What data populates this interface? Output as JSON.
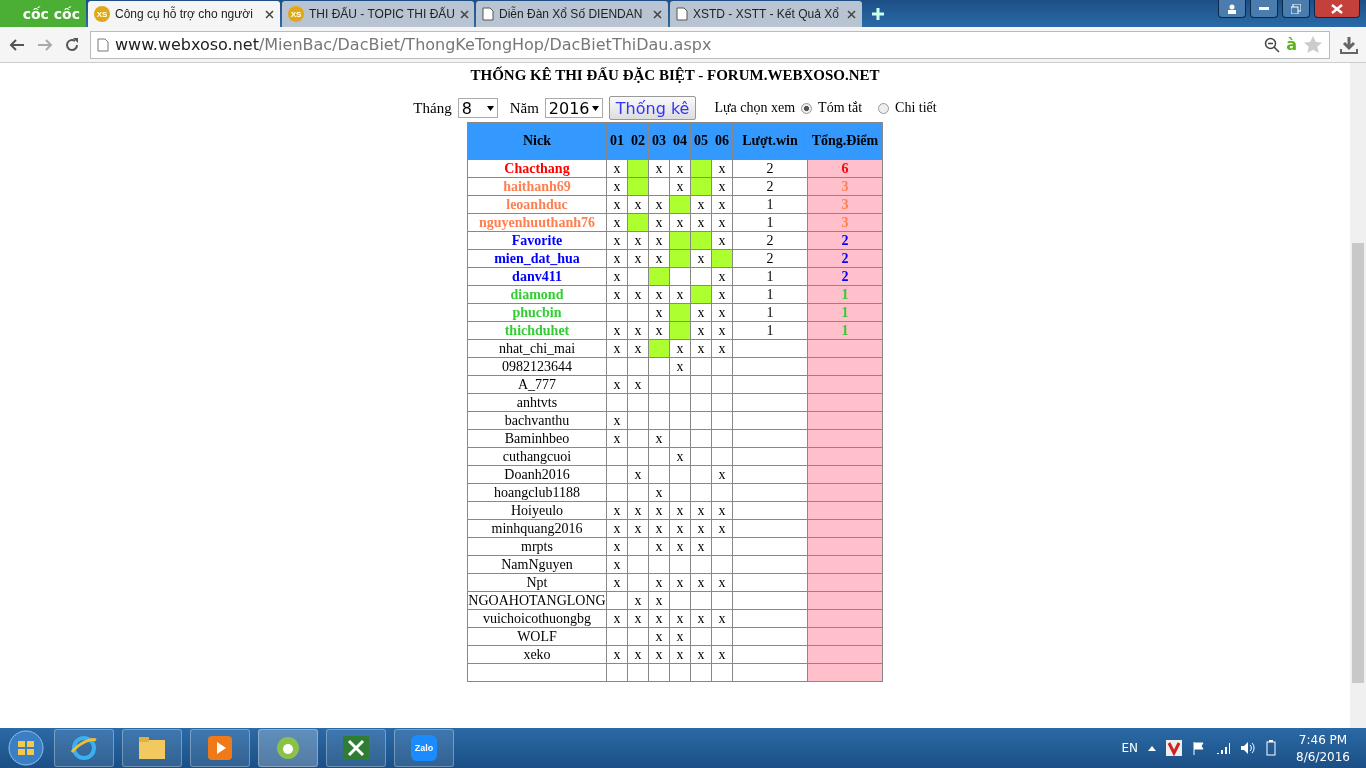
{
  "browser": {
    "logo": "cốc cốc",
    "tabs": [
      {
        "title": "Công cụ hỗ trợ cho người",
        "favicon": "XS",
        "selected": true
      },
      {
        "title": "THI ĐẤU - TOPIC THI ĐẤU",
        "favicon": "XS",
        "selected": false
      },
      {
        "title": "Diễn Đàn Xổ Số DIENDAN",
        "selected": false
      },
      {
        "title": "XSTD - XSTT - Kết Quả Xổ",
        "selected": false
      }
    ],
    "url_host": "www.webxoso.net",
    "url_path": "/MienBac/DacBiet/ThongKeTongHop/DacBietThiDau.aspx",
    "toolbar_letter": "à"
  },
  "page": {
    "title": "THỐNG KÊ THI ĐẤU ĐẶC BIỆT - FORUM.WEBXOSO.NET",
    "month_label": "Tháng",
    "month": "8",
    "year_label": "Năm",
    "year": "2016",
    "submit": "Thống kê",
    "view_label": "Lựa chọn xem",
    "view_options": [
      {
        "label": "Tóm tắt",
        "selected": true
      },
      {
        "label": "Chi tiết",
        "selected": false
      }
    ],
    "columns": [
      "Nick",
      "01",
      "02",
      "03",
      "04",
      "05",
      "06",
      "Lượt.win",
      "Tổng.Điểm"
    ],
    "rows": [
      {
        "cells": [
          {
            "text": "Chacthang"
          },
          {
            "text": "x",
            "win": false
          },
          {
            "win": true
          },
          {
            "text": "x",
            "win": false
          },
          {
            "text": "x",
            "win": false
          },
          {
            "win": true
          },
          {
            "text": "x",
            "win": false
          },
          {
            "text": "2"
          },
          {
            "text": "6"
          }
        ],
        "color": "#ff0000"
      },
      {
        "cells": [
          {
            "text": "haithanh69"
          },
          {
            "text": "x",
            "win": false
          },
          {
            "win": true
          },
          {
            "win": false
          },
          {
            "text": "x",
            "win": false
          },
          {
            "win": true
          },
          {
            "text": "x",
            "win": false
          },
          {
            "text": "2"
          },
          {
            "text": "3"
          }
        ],
        "color": "#ff7f50"
      },
      {
        "cells": [
          {
            "text": "leoanhduc"
          },
          {
            "text": "x",
            "win": false
          },
          {
            "text": "x",
            "win": false
          },
          {
            "text": "x",
            "win": false
          },
          {
            "win": true
          },
          {
            "text": "x",
            "win": false
          },
          {
            "text": "x",
            "win": false
          },
          {
            "text": "1"
          },
          {
            "text": "3"
          }
        ],
        "color": "#ff7f50"
      },
      {
        "cells": [
          {
            "text": "nguyenhuuthanh76"
          },
          {
            "text": "x",
            "win": false
          },
          {
            "win": true
          },
          {
            "text": "x",
            "win": false
          },
          {
            "text": "x",
            "win": false
          },
          {
            "text": "x",
            "win": false
          },
          {
            "text": "x",
            "win": false
          },
          {
            "text": "1"
          },
          {
            "text": "3"
          }
        ],
        "color": "#ff7f50"
      },
      {
        "cells": [
          {
            "text": "Favorite"
          },
          {
            "text": "x",
            "win": false
          },
          {
            "text": "x",
            "win": false
          },
          {
            "text": "x",
            "win": false
          },
          {
            "win": true
          },
          {
            "win": true
          },
          {
            "text": "x",
            "win": false
          },
          {
            "text": "2"
          },
          {
            "text": "2"
          }
        ],
        "color": "#0000ff"
      },
      {
        "cells": [
          {
            "text": "mien_dat_hua"
          },
          {
            "text": "x",
            "win": false
          },
          {
            "text": "x",
            "win": false
          },
          {
            "text": "x",
            "win": false
          },
          {
            "win": true
          },
          {
            "text": "x",
            "win": false
          },
          {
            "win": true
          },
          {
            "text": "2"
          },
          {
            "text": "2"
          }
        ],
        "color": "#0000ff"
      },
      {
        "cells": [
          {
            "text": "danv411"
          },
          {
            "text": "x",
            "win": false
          },
          {
            "win": false
          },
          {
            "win": true
          },
          {
            "win": false
          },
          {
            "win": false
          },
          {
            "text": "x",
            "win": false
          },
          {
            "text": "1"
          },
          {
            "text": "2"
          }
        ],
        "color": "#0000ff"
      },
      {
        "cells": [
          {
            "text": "diamond"
          },
          {
            "text": "x",
            "win": false
          },
          {
            "text": "x",
            "win": false
          },
          {
            "text": "x",
            "win": false
          },
          {
            "text": "x",
            "win": false
          },
          {
            "win": true
          },
          {
            "text": "x",
            "win": false
          },
          {
            "text": "1"
          },
          {
            "text": "1"
          }
        ],
        "color": "#33cc33"
      },
      {
        "cells": [
          {
            "text": "phucbin"
          },
          {
            "win": false
          },
          {
            "win": false
          },
          {
            "text": "x",
            "win": false
          },
          {
            "win": true
          },
          {
            "text": "x",
            "win": false
          },
          {
            "text": "x",
            "win": false
          },
          {
            "text": "1"
          },
          {
            "text": "1"
          }
        ],
        "color": "#33cc33"
      },
      {
        "cells": [
          {
            "text": "thichduhet"
          },
          {
            "text": "x",
            "win": false
          },
          {
            "text": "x",
            "win": false
          },
          {
            "text": "x",
            "win": false
          },
          {
            "win": true
          },
          {
            "text": "x",
            "win": false
          },
          {
            "text": "x",
            "win": false
          },
          {
            "text": "1"
          },
          {
            "text": "1"
          }
        ],
        "color": "#33cc33"
      },
      {
        "cells": [
          {
            "text": "nhat_chi_mai"
          },
          {
            "text": "x",
            "win": false
          },
          {
            "text": "x",
            "win": false
          },
          {
            "win": true
          },
          {
            "text": "x",
            "win": false
          },
          {
            "text": "x",
            "win": false
          },
          {
            "text": "x",
            "win": false
          }
        ]
      },
      {
        "cells": [
          {
            "text": "0982123644"
          },
          {
            "win": false
          },
          {
            "win": false
          },
          {
            "win": false
          },
          {
            "text": "x",
            "win": false
          },
          {
            "win": false
          },
          {
            "win": false
          }
        ]
      },
      {
        "cells": [
          {
            "text": "A_777"
          },
          {
            "text": "x",
            "win": false
          },
          {
            "text": "x",
            "win": false
          },
          {
            "win": false
          },
          {
            "win": false
          },
          {
            "win": false
          },
          {
            "win": false
          }
        ]
      },
      {
        "cells": [
          {
            "text": "anhtvts"
          },
          {
            "win": false
          },
          {
            "win": false
          },
          {
            "win": false
          },
          {
            "win": false
          },
          {
            "win": false
          },
          {
            "win": false
          }
        ]
      },
      {
        "cells": [
          {
            "text": "bachvanthu"
          },
          {
            "text": "x",
            "win": false
          },
          {
            "win": false
          },
          {
            "win": false
          },
          {
            "win": false
          },
          {
            "win": false
          },
          {
            "win": false
          }
        ]
      },
      {
        "cells": [
          {
            "text": "Baminhbeo"
          },
          {
            "text": "x",
            "win": false
          },
          {
            "win": false
          },
          {
            "text": "x",
            "win": false
          },
          {
            "win": false
          },
          {
            "win": false
          },
          {
            "win": false
          }
        ]
      },
      {
        "cells": [
          {
            "text": "cuthangcuoi"
          },
          {
            "win": false
          },
          {
            "win": false
          },
          {
            "win": false
          },
          {
            "text": "x",
            "win": false
          },
          {
            "win": false
          },
          {
            "win": false
          }
        ]
      },
      {
        "cells": [
          {
            "text": "Doanh2016"
          },
          {
            "win": false
          },
          {
            "text": "x",
            "win": false
          },
          {
            "win": false
          },
          {
            "win": false
          },
          {
            "win": false
          },
          {
            "text": "x",
            "win": false
          }
        ]
      },
      {
        "cells": [
          {
            "text": "hoangclub1188"
          },
          {
            "win": false
          },
          {
            "win": false
          },
          {
            "text": "x",
            "win": false
          },
          {
            "win": false
          },
          {
            "win": false
          },
          {
            "win": false
          }
        ]
      },
      {
        "cells": [
          {
            "text": "Hoiyeulo"
          },
          {
            "text": "x",
            "win": false
          },
          {
            "text": "x",
            "win": false
          },
          {
            "text": "x",
            "win": false
          },
          {
            "text": "x",
            "win": false
          },
          {
            "text": "x",
            "win": false
          },
          {
            "text": "x",
            "win": false
          }
        ]
      },
      {
        "cells": [
          {
            "text": "minhquang2016"
          },
          {
            "text": "x",
            "win": false
          },
          {
            "text": "x",
            "win": false
          },
          {
            "text": "x",
            "win": false
          },
          {
            "text": "x",
            "win": false
          },
          {
            "text": "x",
            "win": false
          },
          {
            "text": "x",
            "win": false
          }
        ]
      },
      {
        "cells": [
          {
            "text": "mrpts"
          },
          {
            "text": "x",
            "win": false
          },
          {
            "win": false
          },
          {
            "text": "x",
            "win": false
          },
          {
            "text": "x",
            "win": false
          },
          {
            "text": "x",
            "win": false
          },
          {
            "win": false
          }
        ]
      },
      {
        "cells": [
          {
            "text": "NamNguyen"
          },
          {
            "text": "x",
            "win": false
          },
          {
            "win": false
          },
          {
            "win": false
          },
          {
            "win": false
          },
          {
            "win": false
          },
          {
            "win": false
          }
        ]
      },
      {
        "cells": [
          {
            "text": "Npt"
          },
          {
            "text": "x",
            "win": false
          },
          {
            "win": false
          },
          {
            "text": "x",
            "win": false
          },
          {
            "text": "x",
            "win": false
          },
          {
            "text": "x",
            "win": false
          },
          {
            "text": "x",
            "win": false
          }
        ]
      },
      {
        "cells": [
          {
            "text": "NGOAHOTANGLONG"
          },
          {
            "win": false
          },
          {
            "text": "x",
            "win": false
          },
          {
            "text": "x",
            "win": false
          },
          {
            "win": false
          },
          {
            "win": false
          },
          {
            "win": false
          }
        ]
      },
      {
        "cells": [
          {
            "text": "vuichoicothuongbg"
          },
          {
            "text": "x",
            "win": false
          },
          {
            "text": "x",
            "win": false
          },
          {
            "text": "x",
            "win": false
          },
          {
            "text": "x",
            "win": false
          },
          {
            "text": "x",
            "win": false
          },
          {
            "text": "x",
            "win": false
          }
        ]
      },
      {
        "cells": [
          {
            "text": "WOLF"
          },
          {
            "win": false
          },
          {
            "win": false
          },
          {
            "text": "x",
            "win": false
          },
          {
            "text": "x",
            "win": false
          },
          {
            "win": false
          },
          {
            "win": false
          }
        ]
      },
      {
        "cells": [
          {
            "text": "xeko"
          },
          {
            "text": "x",
            "win": false
          },
          {
            "text": "x",
            "win": false
          },
          {
            "text": "x",
            "win": false
          },
          {
            "text": "x",
            "win": false
          },
          {
            "text": "x",
            "win": false
          },
          {
            "text": "x",
            "win": false
          }
        ]
      }
    ]
  },
  "taskbar": {
    "language": "EN",
    "time": "7:46 PM",
    "date": "8/6/2016",
    "zalo": "Zalo"
  }
}
